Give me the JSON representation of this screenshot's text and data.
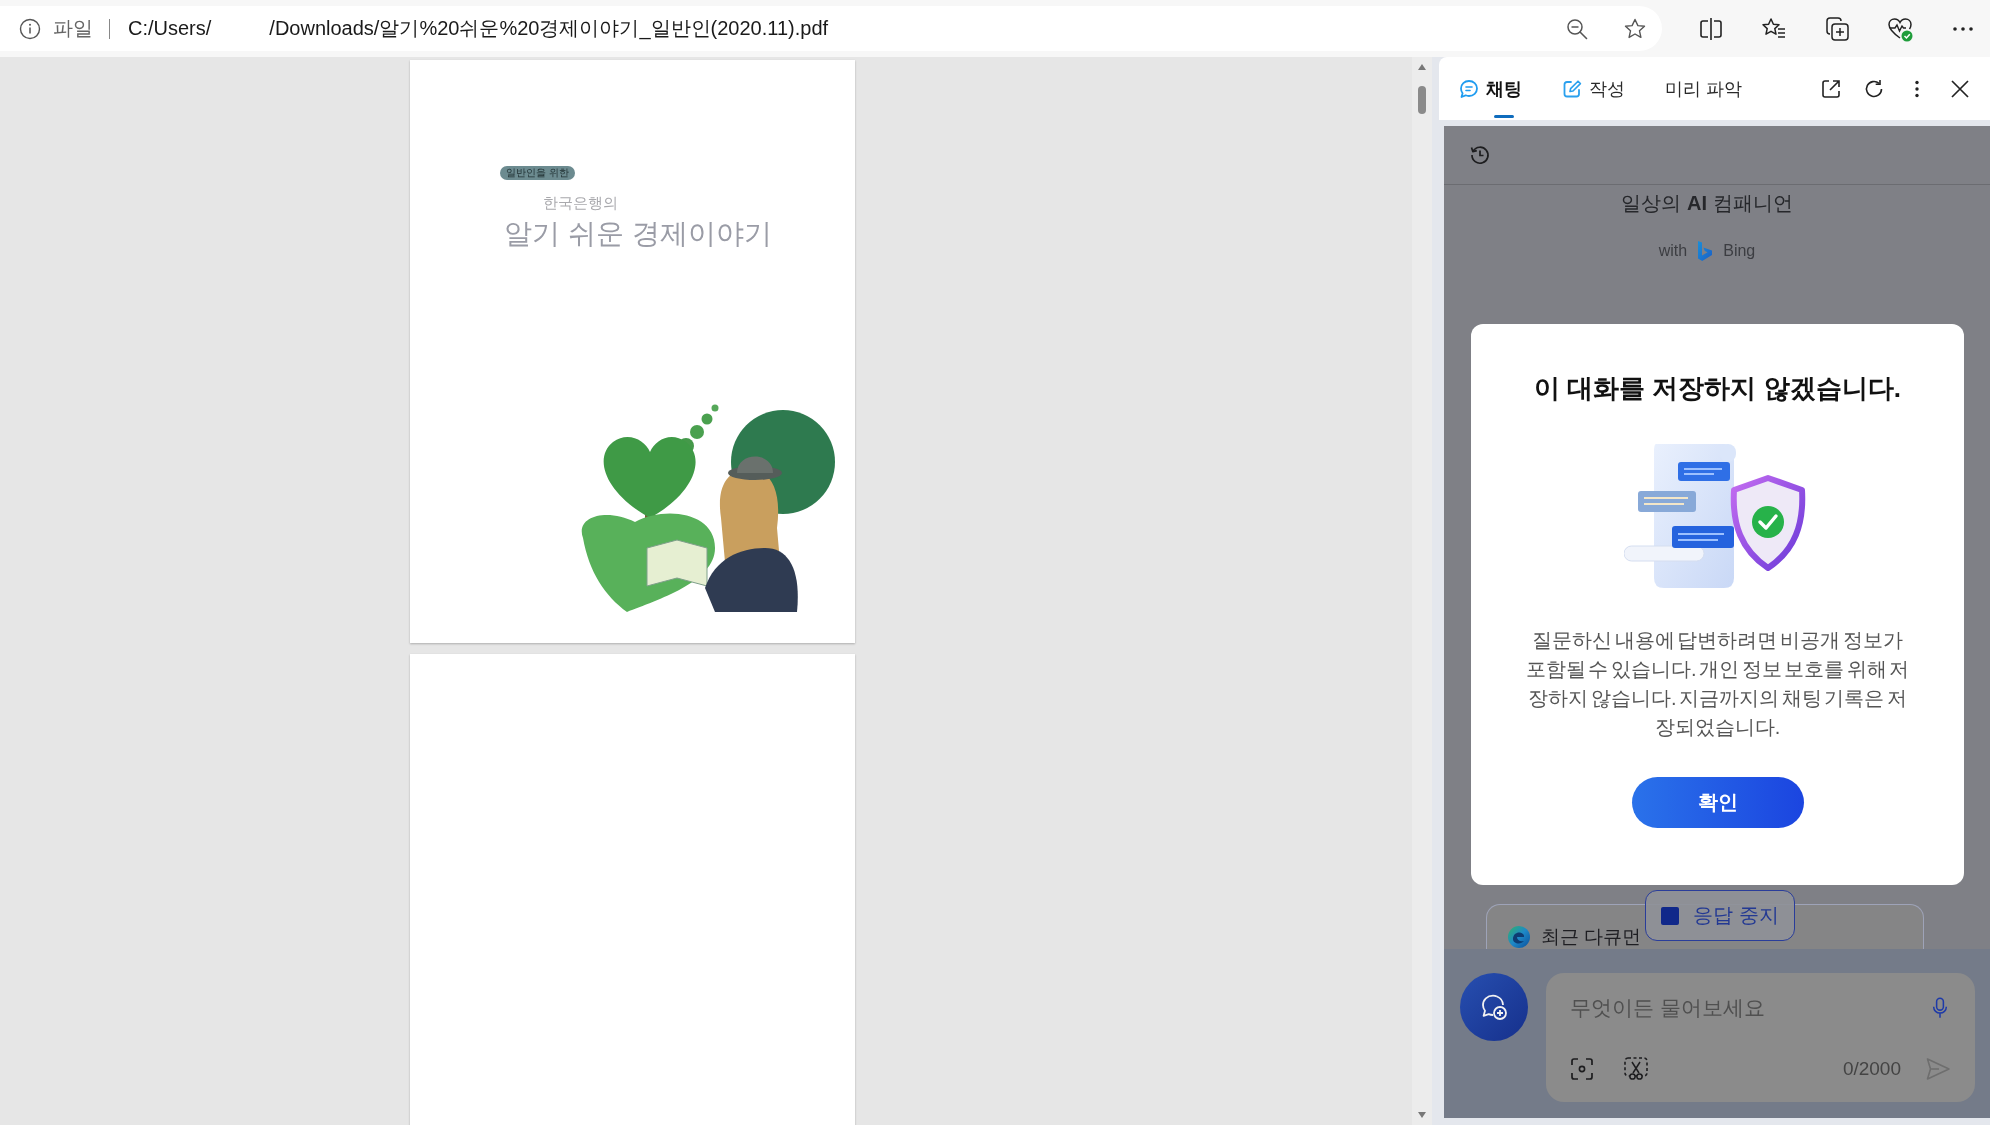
{
  "address_bar": {
    "scheme_label": "파일",
    "path_start": "C:/Users/",
    "path_end": "/Downloads/알기%20쉬운%20경제이야기_일반인(2020.11).pdf"
  },
  "pdf_viewer": {
    "pages": [
      {
        "kind": "cover",
        "badge": "일반인을 위한",
        "subtitle": "한국은행의",
        "title": "알기 쉬운 경제이야기"
      },
      {
        "kind": "blank"
      }
    ]
  },
  "sidebar": {
    "tabs": [
      {
        "kind": "chat",
        "label": "채팅",
        "selected": true
      },
      {
        "kind": "compose",
        "label": "작성",
        "selected": false
      },
      {
        "kind": "insights",
        "label": "미리 파악",
        "selected": false
      }
    ],
    "heading": "일상의 **AI** 컴패니언",
    "with_label": "with",
    "brand": "Bing",
    "recent_card": "최근 다큐먼",
    "stop_button": "응답 중지",
    "input": {
      "placeholder": "무엇이든 물어보세요",
      "counter": "0/2000"
    }
  },
  "dialog": {
    "title": "이 대화를 저장하지 않겠습니다.",
    "message": "질문하신 내용에 답변하려면 비공개 정보가 포함될 수 있습니다. 개인 정보 보호를 위해 저장하지 않습니다. 지금까지의 채팅 기록은 저장되었습니다.",
    "confirm_button": "확인"
  }
}
